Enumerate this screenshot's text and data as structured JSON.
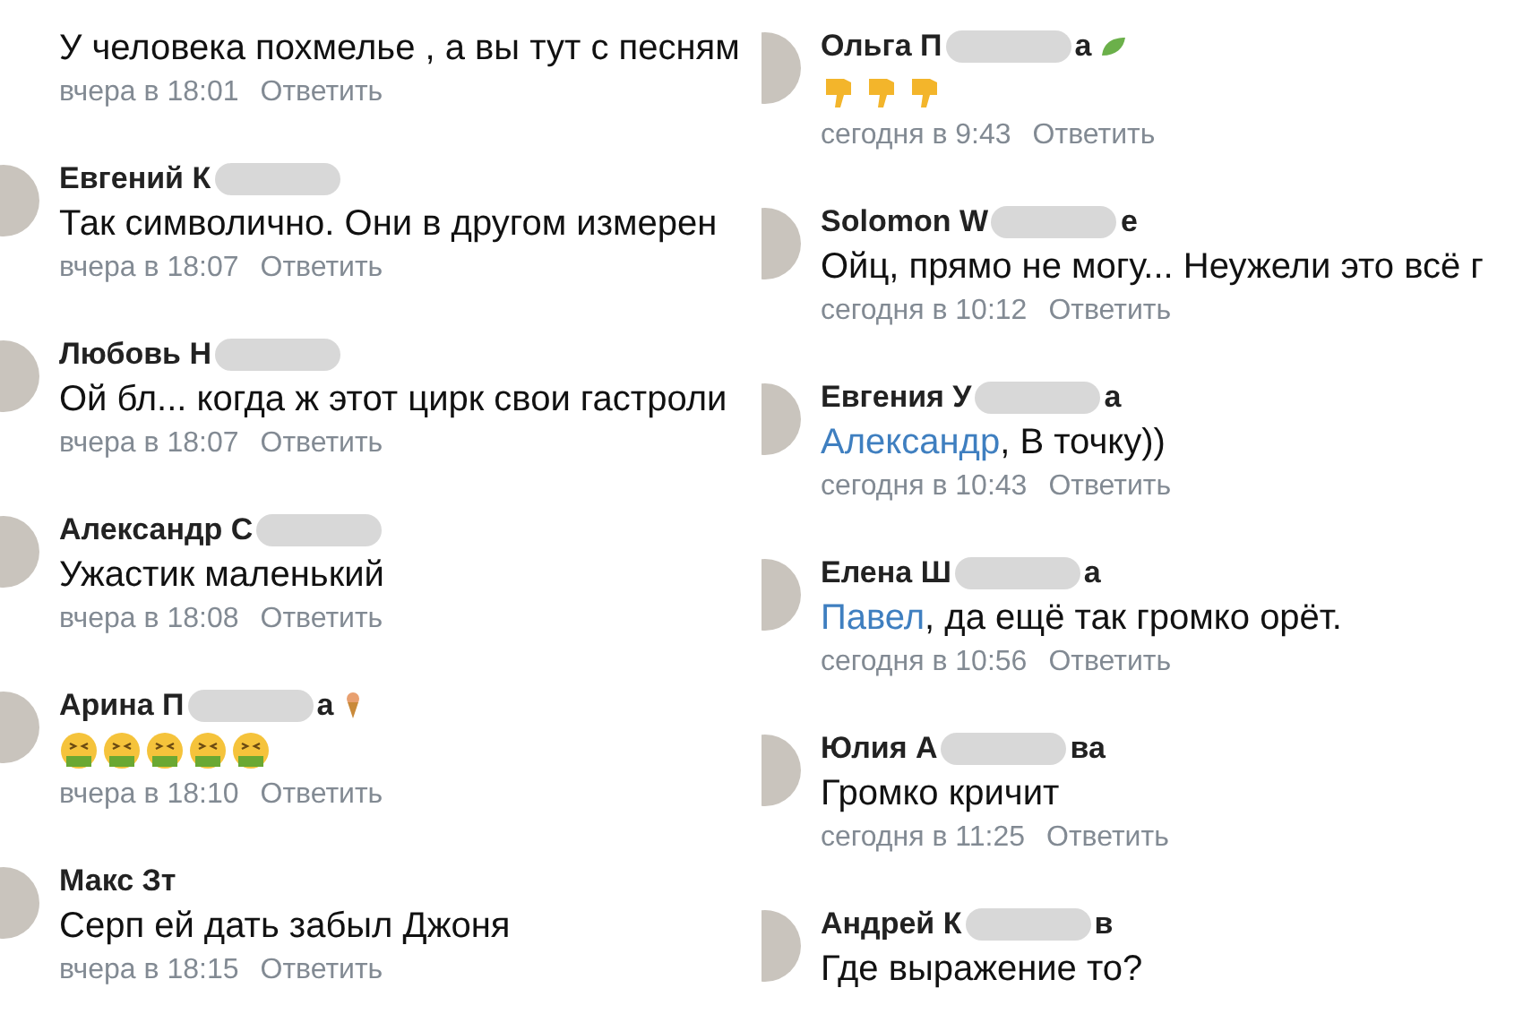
{
  "columns": [
    {
      "comments": [
        {
          "body": {
            "kind": "text",
            "text": "У человека похмелье , а вы тут с песням"
          },
          "time": "вчера в 18:01",
          "reply": "Ответить"
        },
        {
          "name_parts": [
            "Евгений К"
          ],
          "redacted": true,
          "body": {
            "kind": "text",
            "text": "Так символично. Они в другом измерен"
          },
          "time": "вчера в 18:07",
          "reply": "Ответить"
        },
        {
          "name_parts": [
            "Любовь Н"
          ],
          "redacted": true,
          "body": {
            "kind": "text",
            "text": "Ой бл... когда ж этот цирк свои гастроли"
          },
          "time": "вчера в 18:07",
          "reply": "Ответить"
        },
        {
          "name_parts": [
            "Александр С"
          ],
          "redacted": true,
          "body": {
            "kind": "text",
            "text": "Ужастик маленький"
          },
          "time": "вчера в 18:08",
          "reply": "Ответить"
        },
        {
          "name_parts": [
            "Арина П",
            "а"
          ],
          "redacted": true,
          "badge": {
            "kind": "icecream"
          },
          "body": {
            "kind": "emoji",
            "items": [
              {
                "kind": "sick"
              },
              {
                "kind": "sick"
              },
              {
                "kind": "sick"
              },
              {
                "kind": "sick"
              },
              {
                "kind": "sick"
              }
            ]
          },
          "time": "вчера в 18:10",
          "reply": "Ответить"
        },
        {
          "name_parts": [
            "Макс Зт"
          ],
          "body": {
            "kind": "text",
            "text": "Серп ей дать забыл Джоня"
          },
          "time": "вчера в 18:15",
          "reply": "Ответить"
        }
      ]
    },
    {
      "comments": [
        {
          "name_parts": [
            "Ольга П",
            "а"
          ],
          "redacted": true,
          "badge": {
            "kind": "leaf"
          },
          "body": {
            "kind": "emoji",
            "items": [
              {
                "kind": "thumbs-down"
              },
              {
                "kind": "thumbs-down"
              },
              {
                "kind": "thumbs-down"
              }
            ]
          },
          "time": "сегодня в 9:43",
          "reply": "Ответить"
        },
        {
          "name_parts": [
            "Solomon W",
            "e"
          ],
          "redacted": true,
          "body": {
            "kind": "text",
            "text": "Ойц, прямо не могу... Неужели это всё г"
          },
          "time": "сегодня в 10:12",
          "reply": "Ответить"
        },
        {
          "name_parts": [
            "Евгения У",
            "а"
          ],
          "redacted": true,
          "body": {
            "kind": "text",
            "mention": "Александр",
            "text": ", В точку))"
          },
          "time": "сегодня в 10:43",
          "reply": "Ответить"
        },
        {
          "name_parts": [
            "Елена Ш",
            "а"
          ],
          "redacted": true,
          "body": {
            "kind": "text",
            "mention": "Павел",
            "text": ", да ещё так громко орёт."
          },
          "time": "сегодня в 10:56",
          "reply": "Ответить"
        },
        {
          "name_parts": [
            "Юлия А",
            "ва"
          ],
          "redacted": true,
          "body": {
            "kind": "text",
            "text": "Громко кричит"
          },
          "time": "сегодня в 11:25",
          "reply": "Ответить"
        },
        {
          "name_parts": [
            "Андрей К",
            "в"
          ],
          "redacted": true,
          "body": {
            "kind": "text",
            "text": "Где выражение то?"
          }
        }
      ]
    }
  ]
}
